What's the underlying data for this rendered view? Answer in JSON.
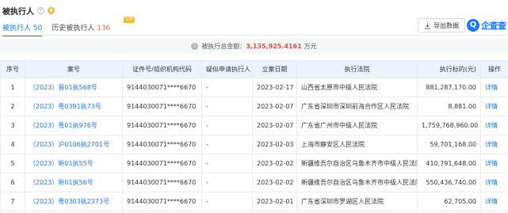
{
  "header": {
    "title": "被执行人",
    "help_glyph": "?"
  },
  "tabs": [
    {
      "label": "被执行人",
      "count": "50",
      "active": true
    },
    {
      "label": "历史被执行人",
      "count": "136",
      "badge": "VIP"
    }
  ],
  "toolbar": {
    "export_label": "导出数据"
  },
  "brand": {
    "mark": "Q",
    "text": "企查查"
  },
  "summary": {
    "label": "被执行总金额：",
    "amount": "3,135,925.4161",
    "unit": "万元",
    "info_glyph": "i"
  },
  "table": {
    "columns": [
      "序号",
      "案号",
      "证件号/组织机构代码",
      "疑似申请执行人",
      "立案日期",
      "执行法院",
      "执行标的(元)",
      "操作"
    ],
    "rows": [
      {
        "seq": "1",
        "case_no": "（2023）晋01执568号",
        "cert": "9144030071****6670",
        "suspect": "-",
        "date": "2023-02-17",
        "court": "山西省太原市中级人民法院",
        "amount": "881,287,170.00",
        "action": "详情"
      },
      {
        "seq": "2",
        "case_no": "（2023）粤0391执73号",
        "cert": "9144030071****6670",
        "suspect": "-",
        "date": "2023-02-07",
        "court": "广东省深圳市深圳前海合作区人民法院",
        "amount": "8,881.00",
        "action": "详情"
      },
      {
        "seq": "3",
        "case_no": "（2023）粤01执976号",
        "cert": "9144030071****6670",
        "suspect": "-",
        "date": "2023-02-07",
        "court": "广东省广州市中级人民法院",
        "amount": "1,759,768,960.00",
        "action": "详情"
      },
      {
        "seq": "4",
        "case_no": "（2023）沪0106执2701号",
        "cert": "9144030071****6670",
        "suspect": "-",
        "date": "2023-02-03",
        "court": "上海市静安区人民法院",
        "amount": "59,701,168.00",
        "action": "详情"
      },
      {
        "seq": "5",
        "case_no": "（2023）新01执55号",
        "cert": "9144030071****6670",
        "suspect": "-",
        "date": "2023-02-02",
        "court": "新疆维吾尔自治区乌鲁木齐市中级人民法院",
        "amount": "410,791,648.00",
        "action": "详情"
      },
      {
        "seq": "6",
        "case_no": "（2023）新01执56号",
        "cert": "9144030071****6670",
        "suspect": "-",
        "date": "2023-02-02",
        "court": "新疆维吾尔自治区乌鲁木齐市中级人民法院",
        "amount": "550,436,740.00",
        "action": "详情"
      },
      {
        "seq": "7",
        "case_no": "（2023）粤0303执2373号",
        "cert": "9144030071****6670",
        "suspect": "-",
        "date": "2023-02-01",
        "court": "广东省深圳市罗湖区人民法院",
        "amount": "62,705.00",
        "action": "详情"
      }
    ]
  },
  "colors": {
    "accent": "#1677ff",
    "amount_red": "#e0533e",
    "header_bg": "#edf3fd",
    "vip_gold": "#f7b733"
  },
  "icons": {
    "export": "download-icon",
    "help": "question-circle-icon",
    "pin": "pin-icon",
    "info": "info-icon",
    "brand": "qichacha-logo-icon"
  }
}
